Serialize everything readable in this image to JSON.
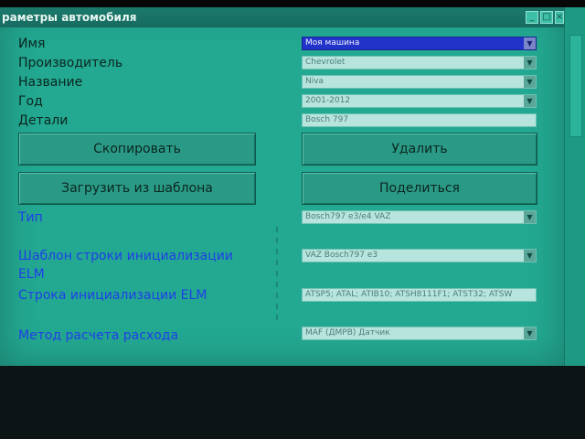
{
  "window": {
    "title": "раметры автомобиля",
    "controls": [
      "minimize-icon",
      "maximize-icon",
      "close-icon"
    ]
  },
  "fields": {
    "name": {
      "label": "Имя",
      "value": "Моя машина",
      "has_dropdown": true,
      "selected": true
    },
    "manufacturer": {
      "label": "Производитель",
      "value": "Chevrolet",
      "has_dropdown": true
    },
    "model": {
      "label": "Название",
      "value": "Niva",
      "has_dropdown": true
    },
    "year": {
      "label": "Год",
      "value": "2001-2012",
      "has_dropdown": true
    },
    "details": {
      "label": "Детали",
      "value": "Bosch 797",
      "has_dropdown": false
    }
  },
  "buttons": {
    "copy": "Скопировать",
    "delete": "Удалить",
    "load_template": "Загрузить из шаблона",
    "share": "Поделиться"
  },
  "settings": {
    "type": {
      "label": "Тип",
      "value": "Bosch797 e3/e4 VAZ"
    },
    "init_template": {
      "label_line1": "Шаблон строки инициализации",
      "label_line2": "ELM",
      "value": "VAZ Bosch797 e3"
    },
    "init_string": {
      "label": "Строка инициализации ELM",
      "value": "ATSP5; ATAL; ATIB10; ATSH8111F1; ATST32; ATSW"
    },
    "consumption_method": {
      "label": "Метод расчета расхода",
      "value": "MAF (ДМРВ) Датчик"
    }
  },
  "colors": {
    "window_bg": "#23a891",
    "label_blue": "#1f3fe8",
    "selected_field": "#2233c9"
  }
}
